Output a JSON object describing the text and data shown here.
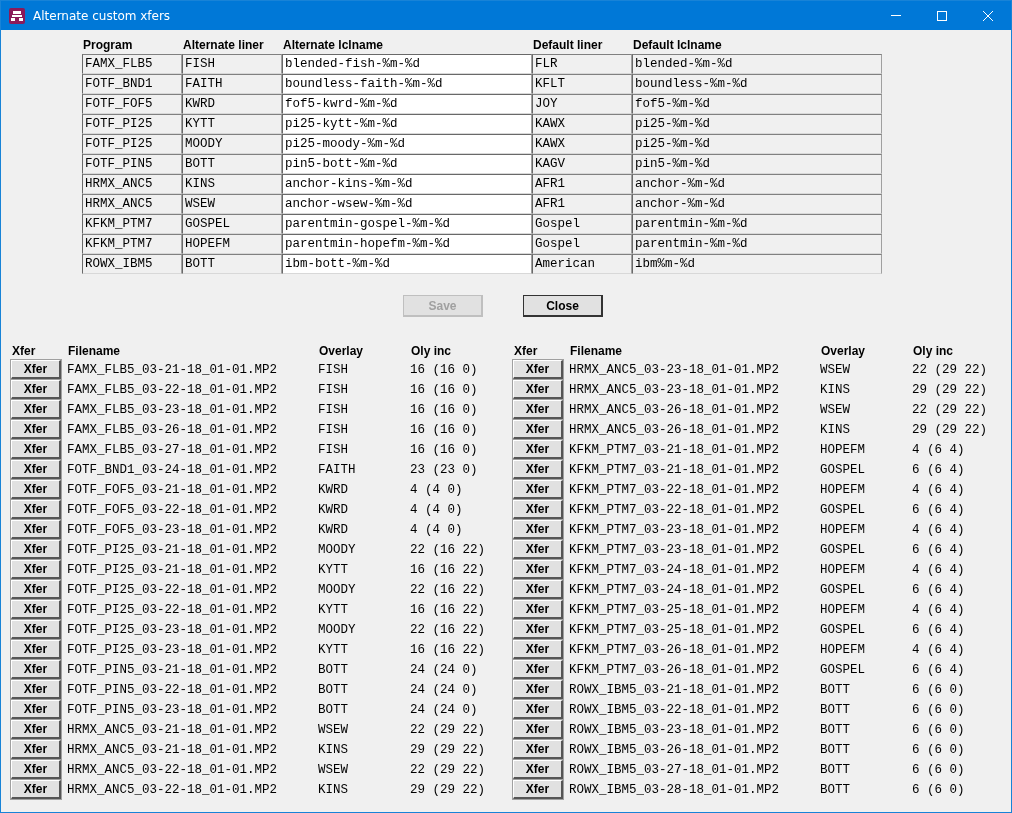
{
  "window": {
    "title": "Alternate custom xfers"
  },
  "liner_table": {
    "columns": [
      "Program",
      "Alternate liner",
      "Alternate lclname",
      "Default liner",
      "Default lclname"
    ],
    "rows": [
      {
        "program": "FAMX_FLB5",
        "alternate_liner": "FISH",
        "alternate_lclname": "blended-fish-%m-%d",
        "default_liner": "FLR",
        "default_lclname": "blended-%m-%d"
      },
      {
        "program": "FOTF_BND1",
        "alternate_liner": "FAITH",
        "alternate_lclname": "boundless-faith-%m-%d",
        "default_liner": "KFLT",
        "default_lclname": "boundless-%m-%d"
      },
      {
        "program": "FOTF_FOF5",
        "alternate_liner": "KWRD",
        "alternate_lclname": "fof5-kwrd-%m-%d",
        "default_liner": "JOY",
        "default_lclname": "fof5-%m-%d"
      },
      {
        "program": "FOTF_PI25",
        "alternate_liner": "KYTT",
        "alternate_lclname": "pi25-kytt-%m-%d",
        "default_liner": "KAWX",
        "default_lclname": "pi25-%m-%d"
      },
      {
        "program": "FOTF_PI25",
        "alternate_liner": "MOODY",
        "alternate_lclname": "pi25-moody-%m-%d",
        "default_liner": "KAWX",
        "default_lclname": "pi25-%m-%d"
      },
      {
        "program": "FOTF_PIN5",
        "alternate_liner": "BOTT",
        "alternate_lclname": "pin5-bott-%m-%d",
        "default_liner": "KAGV",
        "default_lclname": "pin5-%m-%d"
      },
      {
        "program": "HRMX_ANC5",
        "alternate_liner": "KINS",
        "alternate_lclname": "anchor-kins-%m-%d",
        "default_liner": "AFR1",
        "default_lclname": "anchor-%m-%d"
      },
      {
        "program": "HRMX_ANC5",
        "alternate_liner": "WSEW",
        "alternate_lclname": "anchor-wsew-%m-%d",
        "default_liner": "AFR1",
        "default_lclname": "anchor-%m-%d"
      },
      {
        "program": "KFKM_PTM7",
        "alternate_liner": "GOSPEL",
        "alternate_lclname": "parentmin-gospel-%m-%d",
        "default_liner": "Gospel",
        "default_lclname": "parentmin-%m-%d"
      },
      {
        "program": "KFKM_PTM7",
        "alternate_liner": "HOPEFM",
        "alternate_lclname": "parentmin-hopefm-%m-%d",
        "default_liner": "Gospel",
        "default_lclname": "parentmin-%m-%d"
      },
      {
        "program": "ROWX_IBM5",
        "alternate_liner": "BOTT",
        "alternate_lclname": "ibm-bott-%m-%d",
        "default_liner": "American",
        "default_lclname": "ibm%m-%d"
      }
    ]
  },
  "buttons": [
    {
      "label": "Save",
      "disabled": true
    },
    {
      "label": "Close",
      "disabled": false
    }
  ],
  "xfer_lists": [
    {
      "columns": [
        "Xfer",
        "Filename",
        "Overlay",
        "Oly inc"
      ],
      "rows": [
        {
          "button": "Xfer",
          "filename": "FAMX_FLB5_03-21-18_01-01.MP2",
          "overlay": "FISH",
          "oly_inc": "16 (16 0)"
        },
        {
          "button": "Xfer",
          "filename": "FAMX_FLB5_03-22-18_01-01.MP2",
          "overlay": "FISH",
          "oly_inc": "16 (16 0)"
        },
        {
          "button": "Xfer",
          "filename": "FAMX_FLB5_03-23-18_01-01.MP2",
          "overlay": "FISH",
          "oly_inc": "16 (16 0)"
        },
        {
          "button": "Xfer",
          "filename": "FAMX_FLB5_03-26-18_01-01.MP2",
          "overlay": "FISH",
          "oly_inc": "16 (16 0)"
        },
        {
          "button": "Xfer",
          "filename": "FAMX_FLB5_03-27-18_01-01.MP2",
          "overlay": "FISH",
          "oly_inc": "16 (16 0)"
        },
        {
          "button": "Xfer",
          "filename": "FOTF_BND1_03-24-18_01-01.MP2",
          "overlay": "FAITH",
          "oly_inc": "23 (23 0)"
        },
        {
          "button": "Xfer",
          "filename": "FOTF_FOF5_03-21-18_01-01.MP2",
          "overlay": "KWRD",
          "oly_inc": "4 (4 0)"
        },
        {
          "button": "Xfer",
          "filename": "FOTF_FOF5_03-22-18_01-01.MP2",
          "overlay": "KWRD",
          "oly_inc": "4 (4 0)"
        },
        {
          "button": "Xfer",
          "filename": "FOTF_FOF5_03-23-18_01-01.MP2",
          "overlay": "KWRD",
          "oly_inc": "4 (4 0)"
        },
        {
          "button": "Xfer",
          "filename": "FOTF_PI25_03-21-18_01-01.MP2",
          "overlay": "MOODY",
          "oly_inc": "22 (16 22)"
        },
        {
          "button": "Xfer",
          "filename": "FOTF_PI25_03-21-18_01-01.MP2",
          "overlay": "KYTT",
          "oly_inc": "16 (16 22)"
        },
        {
          "button": "Xfer",
          "filename": "FOTF_PI25_03-22-18_01-01.MP2",
          "overlay": "MOODY",
          "oly_inc": "22 (16 22)"
        },
        {
          "button": "Xfer",
          "filename": "FOTF_PI25_03-22-18_01-01.MP2",
          "overlay": "KYTT",
          "oly_inc": "16 (16 22)"
        },
        {
          "button": "Xfer",
          "filename": "FOTF_PI25_03-23-18_01-01.MP2",
          "overlay": "MOODY",
          "oly_inc": "22 (16 22)"
        },
        {
          "button": "Xfer",
          "filename": "FOTF_PI25_03-23-18_01-01.MP2",
          "overlay": "KYTT",
          "oly_inc": "16 (16 22)"
        },
        {
          "button": "Xfer",
          "filename": "FOTF_PIN5_03-21-18_01-01.MP2",
          "overlay": "BOTT",
          "oly_inc": "24 (24 0)"
        },
        {
          "button": "Xfer",
          "filename": "FOTF_PIN5_03-22-18_01-01.MP2",
          "overlay": "BOTT",
          "oly_inc": "24 (24 0)"
        },
        {
          "button": "Xfer",
          "filename": "FOTF_PIN5_03-23-18_01-01.MP2",
          "overlay": "BOTT",
          "oly_inc": "24 (24 0)"
        },
        {
          "button": "Xfer",
          "filename": "HRMX_ANC5_03-21-18_01-01.MP2",
          "overlay": "WSEW",
          "oly_inc": "22 (29 22)"
        },
        {
          "button": "Xfer",
          "filename": "HRMX_ANC5_03-21-18_01-01.MP2",
          "overlay": "KINS",
          "oly_inc": "29 (29 22)"
        },
        {
          "button": "Xfer",
          "filename": "HRMX_ANC5_03-22-18_01-01.MP2",
          "overlay": "WSEW",
          "oly_inc": "22 (29 22)"
        },
        {
          "button": "Xfer",
          "filename": "HRMX_ANC5_03-22-18_01-01.MP2",
          "overlay": "KINS",
          "oly_inc": "29 (29 22)"
        }
      ]
    },
    {
      "columns": [
        "Xfer",
        "Filename",
        "Overlay",
        "Oly inc"
      ],
      "rows": [
        {
          "button": "Xfer",
          "filename": "HRMX_ANC5_03-23-18_01-01.MP2",
          "overlay": "WSEW",
          "oly_inc": "22 (29 22)"
        },
        {
          "button": "Xfer",
          "filename": "HRMX_ANC5_03-23-18_01-01.MP2",
          "overlay": "KINS",
          "oly_inc": "29 (29 22)"
        },
        {
          "button": "Xfer",
          "filename": "HRMX_ANC5_03-26-18_01-01.MP2",
          "overlay": "WSEW",
          "oly_inc": "22 (29 22)"
        },
        {
          "button": "Xfer",
          "filename": "HRMX_ANC5_03-26-18_01-01.MP2",
          "overlay": "KINS",
          "oly_inc": "29 (29 22)"
        },
        {
          "button": "Xfer",
          "filename": "KFKM_PTM7_03-21-18_01-01.MP2",
          "overlay": "HOPEFM",
          "oly_inc": "4 (6 4)"
        },
        {
          "button": "Xfer",
          "filename": "KFKM_PTM7_03-21-18_01-01.MP2",
          "overlay": "GOSPEL",
          "oly_inc": "6 (6 4)"
        },
        {
          "button": "Xfer",
          "filename": "KFKM_PTM7_03-22-18_01-01.MP2",
          "overlay": "HOPEFM",
          "oly_inc": "4 (6 4)"
        },
        {
          "button": "Xfer",
          "filename": "KFKM_PTM7_03-22-18_01-01.MP2",
          "overlay": "GOSPEL",
          "oly_inc": "6 (6 4)"
        },
        {
          "button": "Xfer",
          "filename": "KFKM_PTM7_03-23-18_01-01.MP2",
          "overlay": "HOPEFM",
          "oly_inc": "4 (6 4)"
        },
        {
          "button": "Xfer",
          "filename": "KFKM_PTM7_03-23-18_01-01.MP2",
          "overlay": "GOSPEL",
          "oly_inc": "6 (6 4)"
        },
        {
          "button": "Xfer",
          "filename": "KFKM_PTM7_03-24-18_01-01.MP2",
          "overlay": "HOPEFM",
          "oly_inc": "4 (6 4)"
        },
        {
          "button": "Xfer",
          "filename": "KFKM_PTM7_03-24-18_01-01.MP2",
          "overlay": "GOSPEL",
          "oly_inc": "6 (6 4)"
        },
        {
          "button": "Xfer",
          "filename": "KFKM_PTM7_03-25-18_01-01.MP2",
          "overlay": "HOPEFM",
          "oly_inc": "4 (6 4)"
        },
        {
          "button": "Xfer",
          "filename": "KFKM_PTM7_03-25-18_01-01.MP2",
          "overlay": "GOSPEL",
          "oly_inc": "6 (6 4)"
        },
        {
          "button": "Xfer",
          "filename": "KFKM_PTM7_03-26-18_01-01.MP2",
          "overlay": "HOPEFM",
          "oly_inc": "4 (6 4)"
        },
        {
          "button": "Xfer",
          "filename": "KFKM_PTM7_03-26-18_01-01.MP2",
          "overlay": "GOSPEL",
          "oly_inc": "6 (6 4)"
        },
        {
          "button": "Xfer",
          "filename": "ROWX_IBM5_03-21-18_01-01.MP2",
          "overlay": "BOTT",
          "oly_inc": "6 (6 0)"
        },
        {
          "button": "Xfer",
          "filename": "ROWX_IBM5_03-22-18_01-01.MP2",
          "overlay": "BOTT",
          "oly_inc": "6 (6 0)"
        },
        {
          "button": "Xfer",
          "filename": "ROWX_IBM5_03-23-18_01-01.MP2",
          "overlay": "BOTT",
          "oly_inc": "6 (6 0)"
        },
        {
          "button": "Xfer",
          "filename": "ROWX_IBM5_03-26-18_01-01.MP2",
          "overlay": "BOTT",
          "oly_inc": "6 (6 0)"
        },
        {
          "button": "Xfer",
          "filename": "ROWX_IBM5_03-27-18_01-01.MP2",
          "overlay": "BOTT",
          "oly_inc": "6 (6 0)"
        },
        {
          "button": "Xfer",
          "filename": "ROWX_IBM5_03-28-18_01-01.MP2",
          "overlay": "BOTT",
          "oly_inc": "6 (6 0)"
        }
      ]
    }
  ]
}
